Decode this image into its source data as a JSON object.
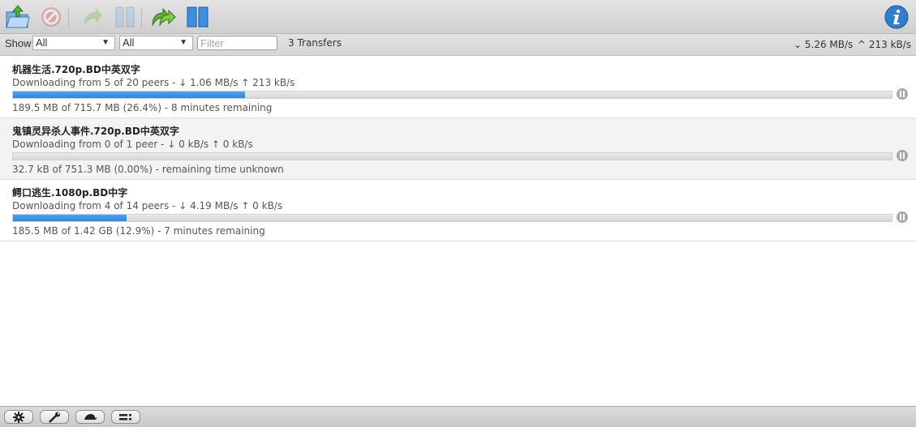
{
  "toolbar": {
    "buttons": [
      {
        "name": "open-torrent",
        "icon": "open-folder-icon",
        "enabled": true
      },
      {
        "name": "remove-torrent",
        "icon": "remove-icon",
        "enabled": false
      },
      {
        "name": "resume-selected",
        "icon": "resume-icon",
        "enabled": false
      },
      {
        "name": "pause-selected",
        "icon": "pause-icon",
        "enabled": false
      },
      {
        "name": "resume-all",
        "icon": "resume-all-icon",
        "enabled": true
      },
      {
        "name": "pause-all",
        "icon": "pause-all-icon",
        "enabled": true
      },
      {
        "name": "inspector",
        "icon": "info-icon",
        "enabled": true
      }
    ]
  },
  "filterbar": {
    "show_label": "Show",
    "state_filter": "All",
    "tracker_filter": "All",
    "filter_placeholder": "Filter",
    "filter_value": "",
    "transfer_count": "3 Transfers",
    "download_speed": "5.26 MB/s",
    "upload_speed": "213 kB/s"
  },
  "torrents": [
    {
      "name": "机器生活.720p.BD中英双字",
      "peers": "Downloading from 5 of 20 peers - ↓ 1.06 MB/s ↑ 213 kB/s",
      "percent": 26.4,
      "progress": "189.5 MB of 715.7 MB (26.4%) - 8 minutes remaining"
    },
    {
      "name": "鬼镇灵异杀人事件.720p.BD中英双字",
      "peers": "Downloading from 0 of 1 peer - ↓ 0 kB/s ↑ 0 kB/s",
      "percent": 0.0,
      "progress": "32.7 kB of 751.3 MB (0.00%) - remaining time unknown"
    },
    {
      "name": "鳄口逃生.1080p.BD中字",
      "peers": "Downloading from 4 of 14 peers - ↓ 4.19 MB/s ↑ 0 kB/s",
      "percent": 12.9,
      "progress": "185.5 MB of 1.42 GB (12.9%) - 7 minutes remaining"
    }
  ],
  "bottombar": {
    "buttons": [
      {
        "name": "settings",
        "icon": "gear-icon"
      },
      {
        "name": "preferences",
        "icon": "wrench-icon"
      },
      {
        "name": "turtle-mode",
        "icon": "turtle-icon"
      },
      {
        "name": "compact-view",
        "icon": "list-view-icon"
      }
    ]
  }
}
